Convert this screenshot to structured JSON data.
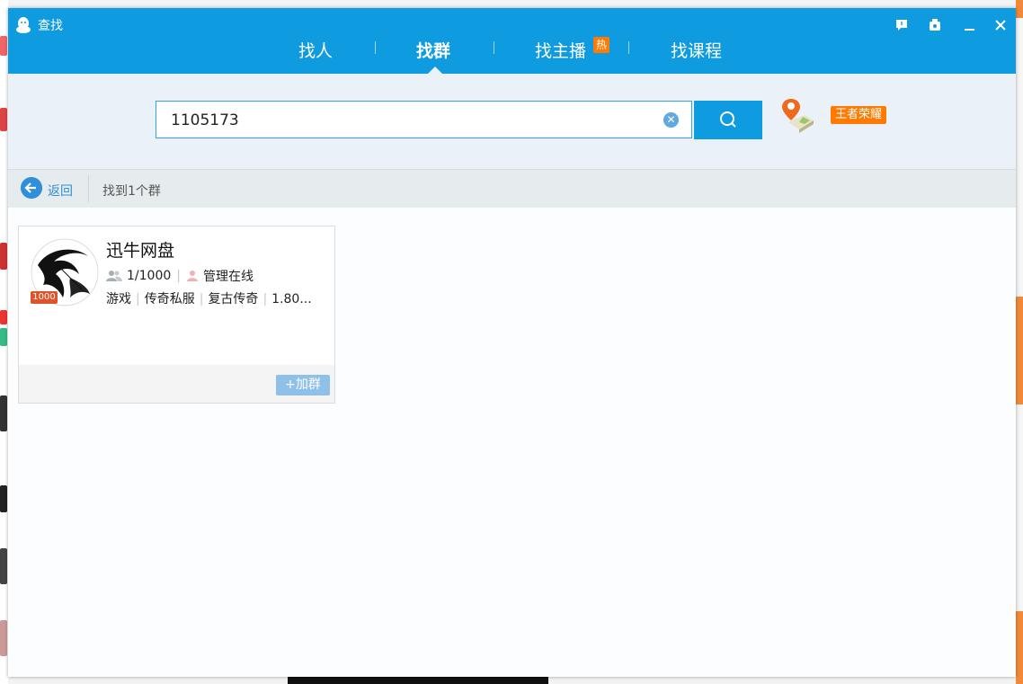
{
  "window": {
    "title": "查找"
  },
  "tabs": [
    {
      "label": "找人",
      "active": false
    },
    {
      "label": "找群",
      "active": true
    },
    {
      "label": "找主播",
      "active": false,
      "badge": "热"
    },
    {
      "label": "找课程",
      "active": false
    }
  ],
  "search": {
    "value": "1105173",
    "placeholder": ""
  },
  "promo_tag": "王者荣耀",
  "results": {
    "back_label": "返回",
    "count_text": "找到1个群"
  },
  "group": {
    "name": "迅牛网盘",
    "capacity_badge": "1000",
    "members": "1/1000",
    "admin_status": "管理在线",
    "tags": [
      "游戏",
      "传奇私服",
      "复古传奇",
      "1.80..."
    ],
    "join_label": "+加群"
  },
  "colors": {
    "brand": "#0f9be0",
    "accent": "#ff7a00",
    "join_button": "#8ec0e8"
  }
}
